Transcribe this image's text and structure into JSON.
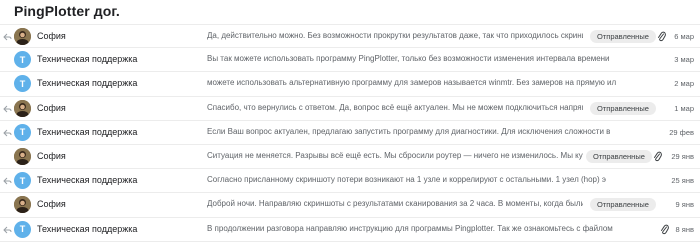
{
  "thread": {
    "title": "PingPlotter дог."
  },
  "colors": {
    "support_avatar": "#5fb1ea",
    "badge_bg": "#ececec",
    "snippet_text": "#5f6368"
  },
  "messages": [
    {
      "reply": true,
      "avatar": "photo",
      "avatar_letter": "",
      "sender": "София",
      "snippet": "Да, действительно можно. Без возможности прокрутки результатов даже, так что приходилось скринить в",
      "badge": "Отправленные",
      "attachment": true,
      "date": "6 мар"
    },
    {
      "reply": false,
      "avatar": "support",
      "avatar_letter": "T",
      "sender": "Техническая поддержка",
      "snippet": "Вы так можете использовать программу PingPlotter, только без возможности изменения интервала времени",
      "badge": "",
      "attachment": false,
      "date": "3 мар"
    },
    {
      "reply": false,
      "avatar": "support",
      "avatar_letter": "T",
      "sender": "Техническая поддержка",
      "snippet": "можете использовать альтернативную программу для замеров называется winmtr. Без замеров на прямую ил",
      "badge": "",
      "attachment": false,
      "date": "2 мар"
    },
    {
      "reply": true,
      "avatar": "photo",
      "avatar_letter": "",
      "sender": "София",
      "snippet": "Спасибо, что вернулись с ответом. Да, вопрос всё ещё актуален. Мы не можем подключиться напрямую...",
      "badge": "Отправленные",
      "attachment": false,
      "date": "1 мар"
    },
    {
      "reply": true,
      "avatar": "support",
      "avatar_letter": "T",
      "sender": "Техническая поддержка",
      "snippet": "Если Ваш вопрос актуален, предлагаю запустить программу для диагностики. Для исключения сложности в",
      "badge": "",
      "attachment": false,
      "date": "29 фев"
    },
    {
      "reply": false,
      "avatar": "photo",
      "avatar_letter": "",
      "sender": "София",
      "snippet": "Ситуация не меняется. Разрывы всё ещё есть. Мы сбросили роутер — ничего не изменилось. Мы купил...",
      "badge": "Отправленные",
      "attachment": true,
      "date": "29 янв"
    },
    {
      "reply": true,
      "avatar": "support",
      "avatar_letter": "T",
      "sender": "Техническая поддержка",
      "snippet": "Согласно присланному скриншоту потери возникают на 1 узле и коррелируют с остальными. 1 узел (hop) э",
      "badge": "",
      "attachment": false,
      "date": "25 янв"
    },
    {
      "reply": false,
      "avatar": "photo",
      "avatar_letter": "",
      "sender": "София",
      "snippet": "Доброй ночи. Направляю скриншоты с результатами сканирования за 2 часа. В моменты, когда были кра...",
      "badge": "Отправленные",
      "attachment": false,
      "date": "9 янв"
    },
    {
      "reply": true,
      "avatar": "support",
      "avatar_letter": "T",
      "sender": "Техническая поддержка",
      "snippet": "В продолжении разговора направляю инструкцию для программы Pingplotter. Так же ознакомьтесь с файлом",
      "badge": "",
      "attachment": true,
      "date": "8 янв"
    }
  ]
}
